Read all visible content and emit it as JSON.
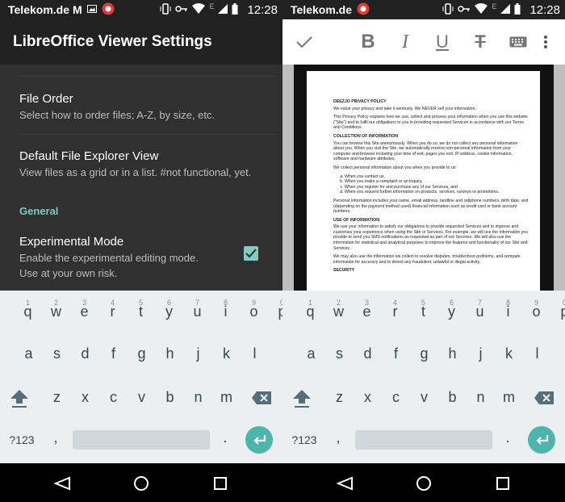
{
  "status_bar": {
    "carrier": "Telekom.de",
    "time": "12:28",
    "network_letter": "E"
  },
  "settings_screen": {
    "title": "LibreOffice Viewer Settings",
    "items": [
      {
        "title": "File Order",
        "summary": "Select how to order files; A-Z, by size, etc."
      },
      {
        "title": "Default File Explorer View",
        "summary": "View files as a grid or in a list. #not functional, yet."
      }
    ],
    "category": "General",
    "experimental": {
      "title": "Experimental Mode",
      "summary_line1": "Enable the experimental editing mode.",
      "summary_line2": "Use at your own risk.",
      "checked": true
    }
  },
  "editor_screen": {
    "toolbar": {
      "confirm_icon": "checkmark-icon",
      "bold": "B",
      "italic": "I",
      "underline": "U",
      "strikethrough": "T",
      "keyboard_icon": "keyboard-icon",
      "overflow_icon": "overflow-menu-icon"
    },
    "document": {
      "h1": "DEEZJO PRIVACY POLICY",
      "p1": "We value your privacy and take it seriously.  We NEVER sell your information.",
      "p2": "This Privacy Policy explains how we use, collect and process your information when you use this website (\"Site\") and to fulfil our obligations to you in providing requested Services in accordance with our Terms and Conditions.",
      "h2": "COLLECTION OF INFORMATION",
      "p3": "You can browse this Site anonymously.  When you do so, we do not collect any personal information about you.   When you visit the Site, we automatically receive non-personal information from your computer and browser including your time of exit, pages you exit, IP address, cookie information, software and hardware attributes.",
      "p4": "We collect personal information about you when you provide to us:",
      "list": [
        "When you contact us,",
        "When you make a complaint or an inquiry,",
        "When you register for and purchase any of our Services, and",
        "When you request further information on products, services, surveys or promotions."
      ],
      "p5": "Personal information includes your name, email address, landline and cellphone numbers, birth date, and (depending on the payment method used) financial information such as credit card or bank account numbers.",
      "h3": "USE OF INFORMATION",
      "p6": "We use your information to satisfy our obligations to provide requested Services and to improve and customize your experience when using the Site or Services.  For example, we will use the information you provide to send you SMS notifications as requested as part of our Services.  We will also use the information for statistical and analytical purposes to improve the features and functionality of our Site and Services.",
      "p7": "We may also use the information we collect to resolve disputes, troubleshoot problems, and compare information for accuracy and to detect any fraudulent, unlawful or illegal activity.",
      "h4": "SECURITY"
    }
  },
  "keyboard": {
    "row1": [
      "q",
      "w",
      "e",
      "r",
      "t",
      "y",
      "u",
      "i",
      "o",
      "p"
    ],
    "row1_hints": [
      "1",
      "2",
      "3",
      "4",
      "5",
      "6",
      "7",
      "8",
      "9",
      "0"
    ],
    "row2": [
      "a",
      "s",
      "d",
      "f",
      "g",
      "h",
      "j",
      "k",
      "l"
    ],
    "row3": [
      "z",
      "x",
      "c",
      "v",
      "b",
      "n",
      "m"
    ],
    "symbols_label": "?123",
    "comma": ",",
    "period": "."
  }
}
